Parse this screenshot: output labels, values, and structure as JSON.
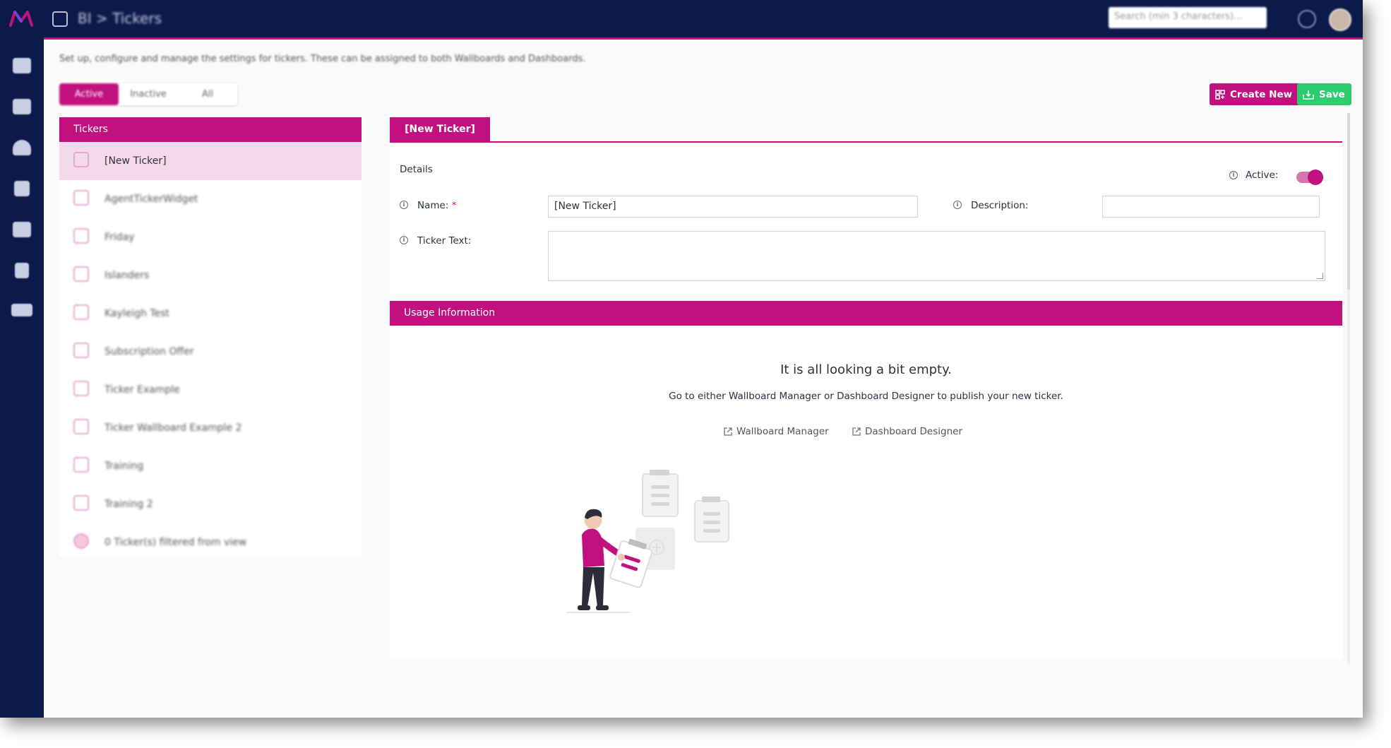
{
  "topbar": {
    "breadcrumb": "BI > Tickers",
    "search_placeholder": "Search (min 3 characters)..."
  },
  "page": {
    "description": "Set up, configure and manage the settings for tickers. These can be assigned to both Wallboards and Dashboards."
  },
  "status_tabs": [
    {
      "label": "Active"
    },
    {
      "label": "Inactive"
    },
    {
      "label": "All"
    }
  ],
  "toolbar": {
    "create_label": "Create New",
    "save_label": "Save"
  },
  "tickers": {
    "header": "Tickers",
    "items": [
      {
        "label": "[New Ticker]"
      },
      {
        "label": "AgentTickerWidget"
      },
      {
        "label": "Friday"
      },
      {
        "label": "Islanders"
      },
      {
        "label": "Kayleigh Test"
      },
      {
        "label": "Subscription Offer"
      },
      {
        "label": "Ticker Example"
      },
      {
        "label": "Ticker Wallboard Example 2"
      },
      {
        "label": "Training"
      },
      {
        "label": "Training 2"
      },
      {
        "label": "0 Ticker(s) filtered from view"
      }
    ]
  },
  "editor": {
    "tab_label": "[New Ticker]",
    "details_title": "Details",
    "active_label": "Active:",
    "active_on": true,
    "name_label": "Name:",
    "required_mark": "*",
    "name_value": "[New Ticker]",
    "description_label": "Description:",
    "description_value": "",
    "ticker_text_label": "Ticker Text:"
  },
  "usage": {
    "header": "Usage Information",
    "empty_title": "It is all looking a bit empty.",
    "empty_sub": "Go to either Wallboard Manager or Dashboard Designer to publish your new ticker.",
    "link_wallboard": "Wallboard Manager",
    "link_dashboard": "Dashboard Designer"
  },
  "colors": {
    "brand": "#c2107f",
    "navy": "#0b1a4a",
    "success": "#2ecc71"
  }
}
